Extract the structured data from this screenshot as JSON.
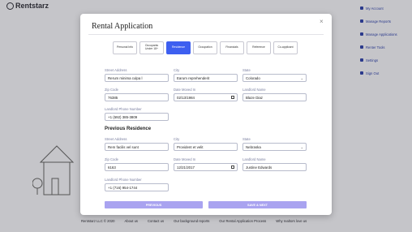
{
  "brand": {
    "name": "Rentstarz"
  },
  "right_nav": {
    "account": "My Account",
    "items": [
      "Manage Reports",
      "Manage Applications",
      "Renter Tools",
      "Settings",
      "Sign Out"
    ]
  },
  "footer": {
    "links": [
      "Rentstarz LLC © 2020",
      "About us",
      "Contact us",
      "Our background reports",
      "Our Rental Application Process",
      "Why realtors love us"
    ]
  },
  "modal": {
    "title": "Rental Application",
    "close": "×",
    "tabs": [
      "Personal Info",
      "Occupants Under 18+",
      "Residence",
      "Occupation",
      "Financials",
      "Reference",
      "Co-applicant"
    ],
    "active_tab": "Residence"
  },
  "current_residence": {
    "street_label": "Street Address",
    "street": "Rerum minima culpa l",
    "city_label": "City",
    "city": "Earum reprehenderit",
    "state_label": "State",
    "state": "Colorado",
    "zip_label": "Zip Code",
    "zip": "76385",
    "date_label": "Date Moved In",
    "date": "02/13/1984",
    "landlord_label": "Landlord Name",
    "landlord": "Blaze Diaz",
    "phone_label": "Landlord Phone Number",
    "phone": "+1 (592) 385-3809"
  },
  "previous_residence": {
    "section_title": "Previous Residence",
    "street_label": "Street Address",
    "street": "Rem facilis vel sunt",
    "city_label": "City",
    "city": "Provident et velit",
    "state_label": "State",
    "state": "Nebraska",
    "zip_label": "Zip Code",
    "zip": "6163",
    "date_label": "Date Moved In",
    "date": "12/21/2017",
    "landlord_label": "Landlord Name",
    "landlord": "Justine Edwards",
    "phone_label": "Landlord Phone Number",
    "phone": "+1 (716) 954-1744"
  },
  "actions": {
    "previous": "PREVIOUS",
    "save_next": "SAVE & NEXT"
  },
  "colors": {
    "accent": "#3d5ff0",
    "button": "#a9a3f0"
  }
}
